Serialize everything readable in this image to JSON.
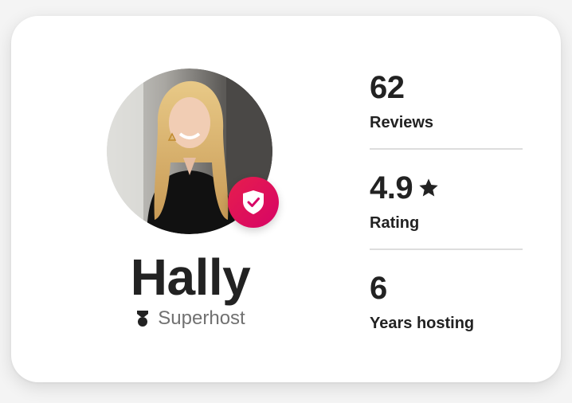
{
  "host": {
    "name": "Hally",
    "status_label": "Superhost",
    "badge_color": "#e61e4d",
    "badge_icon": "shield-check-icon",
    "status_icon": "superhost-medal-icon"
  },
  "stats": [
    {
      "value": "62",
      "label": "Reviews"
    },
    {
      "value": "4.9",
      "label": "Rating",
      "icon": "star-icon"
    },
    {
      "value": "6",
      "label": "Years hosting"
    }
  ]
}
